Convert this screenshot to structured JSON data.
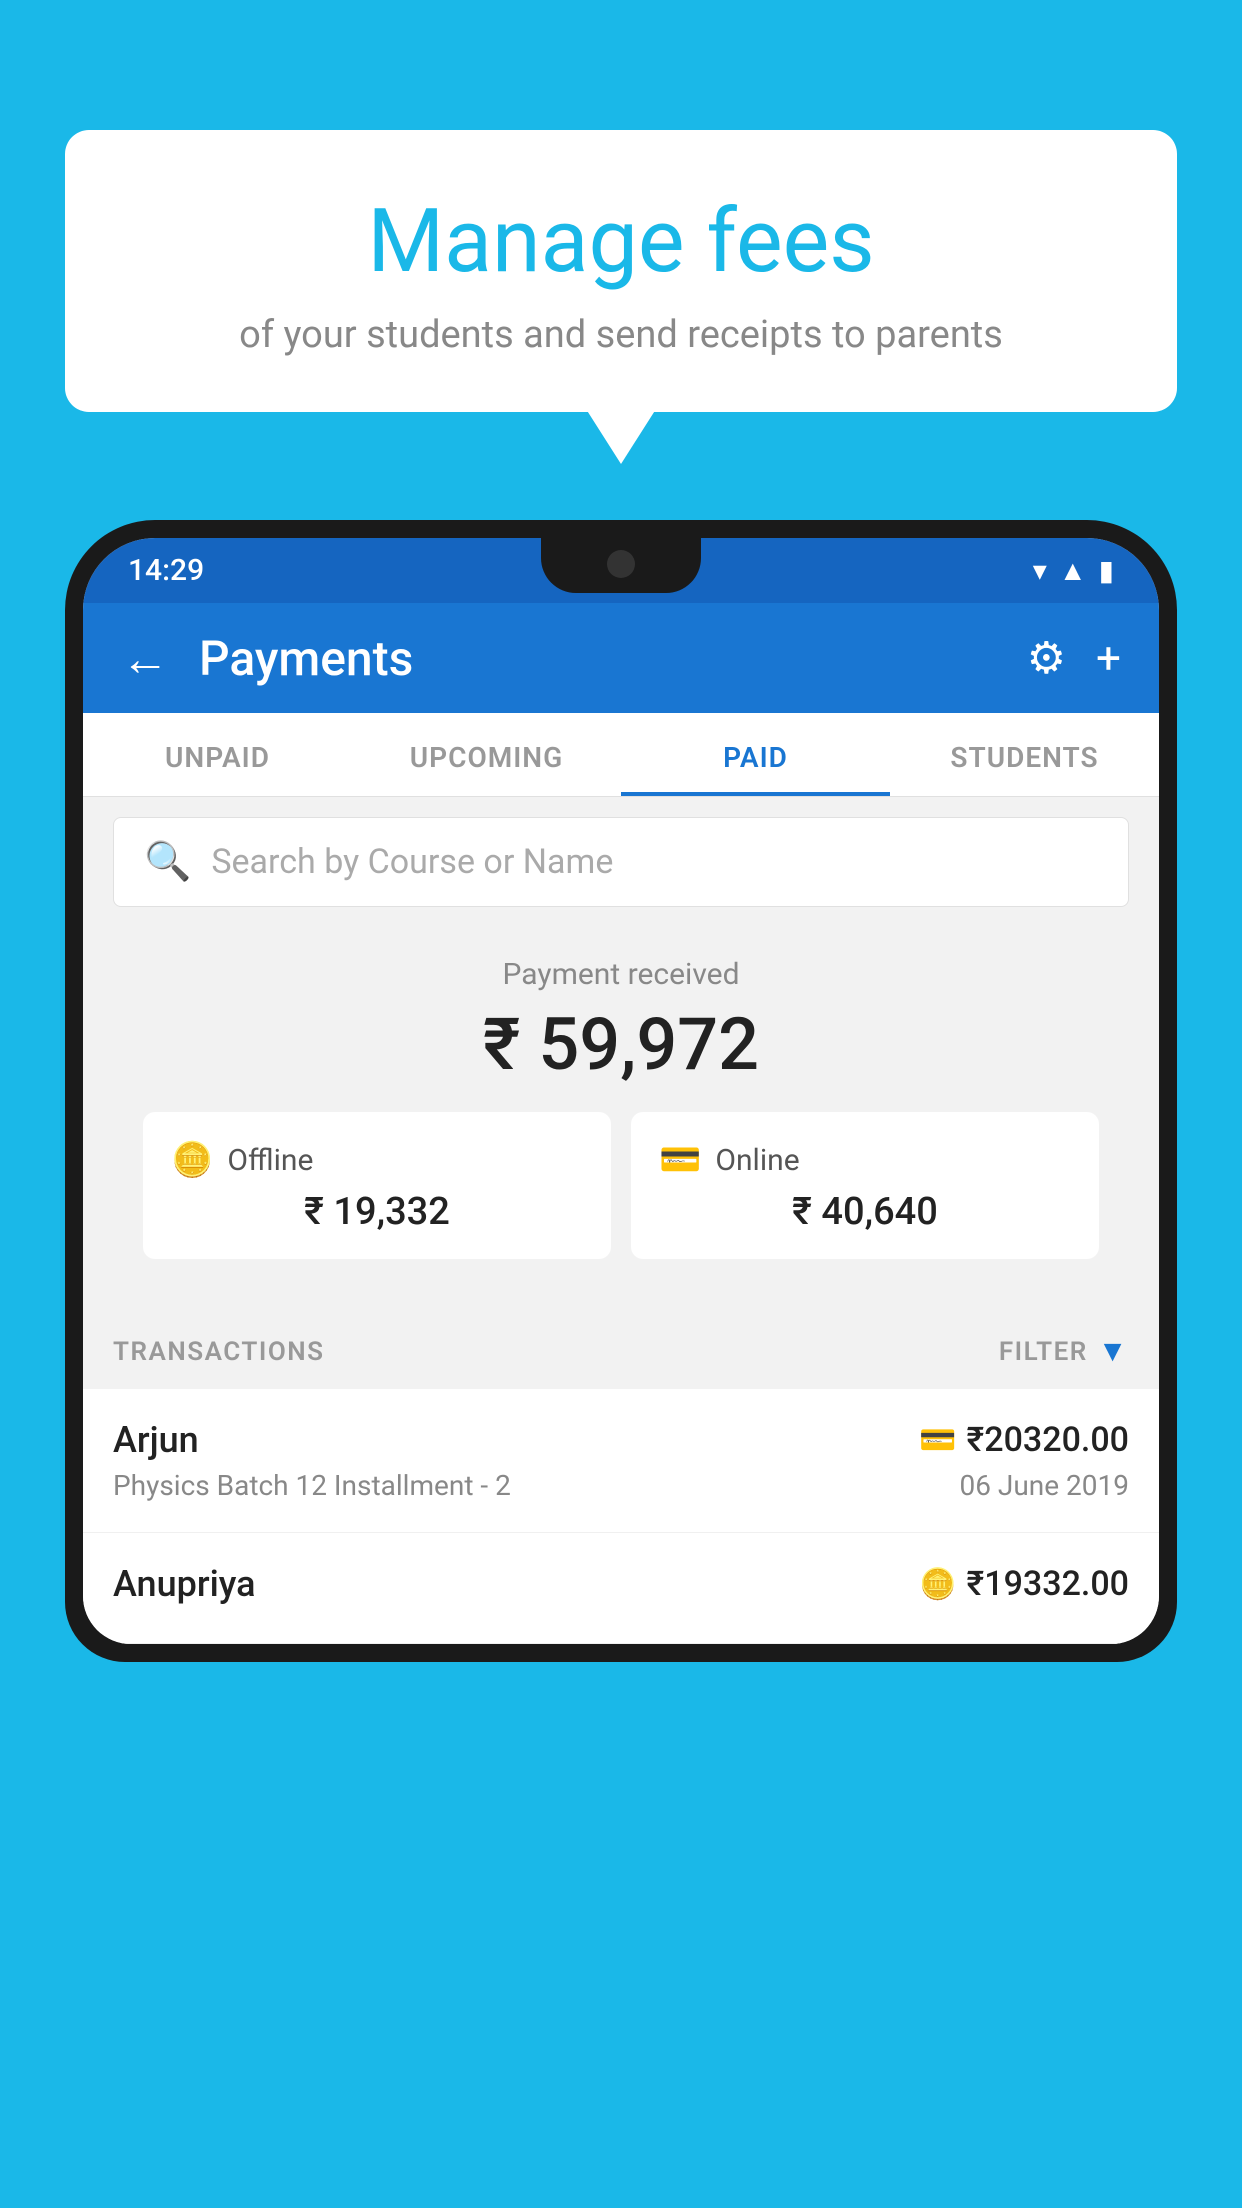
{
  "background_color": "#1ab8e8",
  "hero": {
    "title": "Manage fees",
    "subtitle": "of your students and send receipts to parents"
  },
  "phone": {
    "status_bar": {
      "time": "14:29",
      "icons": [
        "wifi",
        "signal",
        "battery"
      ]
    },
    "app_bar": {
      "title": "Payments",
      "back_label": "←",
      "settings_label": "⚙",
      "add_label": "+"
    },
    "tabs": [
      {
        "label": "UNPAID",
        "active": false
      },
      {
        "label": "UPCOMING",
        "active": false
      },
      {
        "label": "PAID",
        "active": true
      },
      {
        "label": "STUDENTS",
        "active": false
      }
    ],
    "search": {
      "placeholder": "Search by Course or Name"
    },
    "payment_summary": {
      "label": "Payment received",
      "total": "₹ 59,972",
      "offline_label": "Offline",
      "offline_amount": "₹ 19,332",
      "online_label": "Online",
      "online_amount": "₹ 40,640"
    },
    "transactions": {
      "header": "TRANSACTIONS",
      "filter": "FILTER",
      "items": [
        {
          "name": "Arjun",
          "course": "Physics Batch 12 Installment - 2",
          "amount": "₹20320.00",
          "date": "06 June 2019",
          "payment_type": "card"
        },
        {
          "name": "Anupriya",
          "course": "",
          "amount": "₹19332.00",
          "date": "",
          "payment_type": "offline"
        }
      ]
    }
  }
}
